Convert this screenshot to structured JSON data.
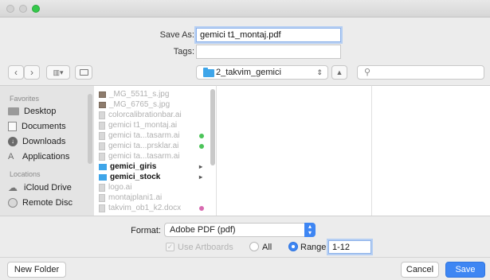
{
  "header": {
    "save_as_label": "Save As:",
    "save_as_value": "gemici t1_montaj.pdf",
    "tags_label": "Tags:",
    "tags_value": ""
  },
  "toolbar": {
    "back_icon": "chevron-left-icon",
    "forward_icon": "chevron-right-icon",
    "view_icon": "column-view-icon",
    "new_folder_icon": "folder-outline-icon",
    "current_folder": "2_takvim_gemici",
    "search_icon": "magnifier-icon"
  },
  "sidebar": {
    "favorites_header": "Favorites",
    "locations_header": "Locations",
    "favorites": [
      {
        "label": "Desktop",
        "icon": "desktop-icon"
      },
      {
        "label": "Documents",
        "icon": "documents-icon"
      },
      {
        "label": "Downloads",
        "icon": "downloads-icon"
      },
      {
        "label": "Applications",
        "icon": "applications-icon"
      }
    ],
    "locations": [
      {
        "label": "iCloud Drive",
        "icon": "cloud-icon"
      },
      {
        "label": "Remote Disc",
        "icon": "disc-icon"
      }
    ]
  },
  "files": [
    {
      "name": "_MG_5511_s.jpg",
      "style": "dim",
      "icon": "image"
    },
    {
      "name": "_MG_6765_s.jpg",
      "style": "dim",
      "icon": "image"
    },
    {
      "name": "colorcalibrationbar.ai",
      "style": "dim",
      "icon": "doc"
    },
    {
      "name": "gemici t1_montaj.ai",
      "style": "dim",
      "icon": "doc"
    },
    {
      "name": "gemici ta...tasarm.ai",
      "style": "dim",
      "icon": "doc",
      "tag": "#4cc459"
    },
    {
      "name": "gemici ta...prsklar.ai",
      "style": "dim",
      "icon": "doc",
      "tag": "#4cc459"
    },
    {
      "name": "gemici ta...tasarm.ai",
      "style": "dim",
      "icon": "doc"
    },
    {
      "name": "gemici_giris",
      "style": "bold",
      "icon": "folder",
      "arrow": "▸"
    },
    {
      "name": "gemici_stock",
      "style": "bold",
      "icon": "folder",
      "arrow": "▸"
    },
    {
      "name": "logo.ai",
      "style": "dim",
      "icon": "doc"
    },
    {
      "name": "montajplani1.ai",
      "style": "dim",
      "icon": "doc"
    },
    {
      "name": "takvim_ob1_k2.docx",
      "style": "dim",
      "icon": "doc",
      "tag": "#d86ab0"
    }
  ],
  "options": {
    "format_label": "Format:",
    "format_value": "Adobe PDF (pdf)",
    "use_artboards_label": "Use Artboards",
    "use_artboards_checked": true,
    "all_label": "All",
    "range_label": "Range:",
    "range_value": "1-12",
    "range_selected": true
  },
  "footer": {
    "new_folder": "New Folder",
    "cancel": "Cancel",
    "save": "Save"
  }
}
